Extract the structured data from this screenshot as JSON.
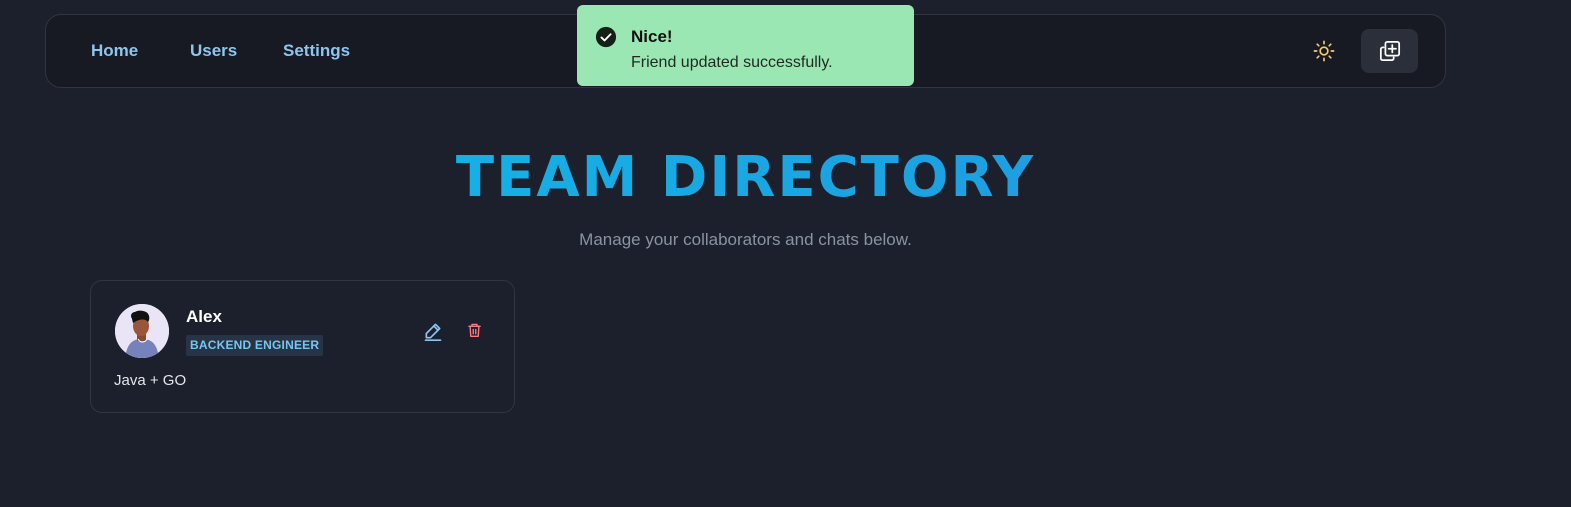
{
  "navbar": {
    "links": [
      {
        "label": "Home"
      },
      {
        "label": "Users"
      },
      {
        "label": "Settings"
      }
    ],
    "theme_toggle_icon": "sun-icon",
    "add_button_icon": "add-copy-icon"
  },
  "toast": {
    "title": "Nice!",
    "message": "Friend updated successfully.",
    "icon": "check-circle-icon",
    "background": "#9be7b3"
  },
  "header": {
    "title": "TEAM DIRECTORY",
    "subtitle": "Manage your collaborators and chats below."
  },
  "friends": [
    {
      "name": "Alex",
      "role": "BACKEND ENGINEER",
      "description": "Java + GO",
      "avatar_icon": "avatar",
      "edit_icon": "pencil-icon",
      "delete_icon": "trash-icon"
    }
  ],
  "colors": {
    "background": "#1b202c",
    "nav_link": "#8ec5ef",
    "title_gradient_start": "#11bde8",
    "title_gradient_end": "#2192de",
    "badge_text": "#79c5ee",
    "delete": "#ff7a85"
  }
}
